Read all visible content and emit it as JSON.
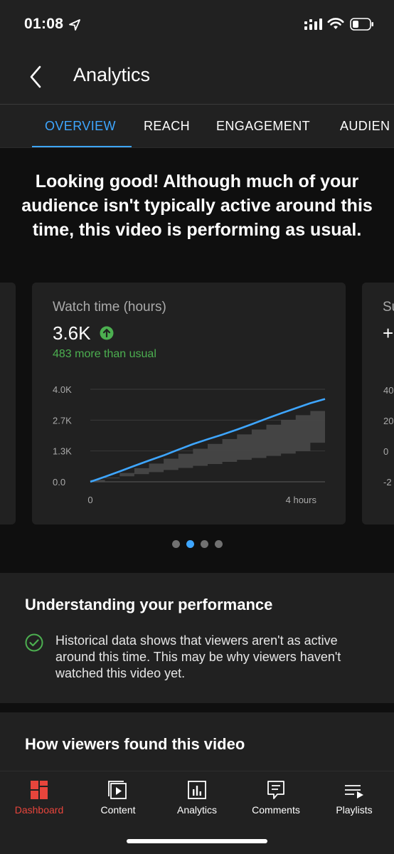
{
  "status_bar": {
    "time": "01:08"
  },
  "header": {
    "title": "Analytics"
  },
  "tabs": [
    {
      "label": "OVERVIEW",
      "active": true
    },
    {
      "label": "REACH",
      "active": false
    },
    {
      "label": "ENGAGEMENT",
      "active": false
    },
    {
      "label": "AUDIEN",
      "active": false
    }
  ],
  "headline": "Looking good! Although much of your audience isn't typically active around this time, this video is performing as usual.",
  "card": {
    "label": "Watch time (hours)",
    "value": "3.6K",
    "comparison": "483 more than usual"
  },
  "peek_card": {
    "label": "Su",
    "value": "+",
    "ticks": [
      "40",
      "20",
      "0",
      "-2"
    ]
  },
  "chart_data": {
    "type": "line",
    "title": "",
    "xlabel": "",
    "ylabel": "",
    "x_ticks": [
      "0",
      "4 hours"
    ],
    "y_ticks": [
      "4.0K",
      "2.7K",
      "1.3K",
      "0.0"
    ],
    "x_range": [
      0,
      4
    ],
    "ylim": [
      0,
      4000
    ],
    "grid": true,
    "series": [
      {
        "type": "line",
        "color": "#3ea6ff",
        "x": [
          0,
          0.25,
          0.5,
          0.75,
          1.0,
          1.25,
          1.5,
          1.75,
          2.0,
          2.25,
          2.5,
          2.75,
          3.0,
          3.25,
          3.5,
          3.75,
          4.0
        ],
        "y": [
          0,
          220,
          450,
          690,
          920,
          1140,
          1390,
          1630,
          1840,
          2040,
          2260,
          2490,
          2730,
          2960,
          3180,
          3400,
          3580
        ]
      },
      {
        "type": "band",
        "color": "#4a4a4a",
        "x": [
          0,
          0.25,
          0.5,
          0.75,
          1.0,
          1.25,
          1.5,
          1.75,
          2.0,
          2.25,
          2.5,
          2.75,
          3.0,
          3.25,
          3.5,
          3.75,
          4.0
        ],
        "low": [
          0,
          80,
          150,
          240,
          330,
          420,
          510,
          600,
          690,
          770,
          860,
          950,
          1030,
          1120,
          1220,
          1330,
          1690
        ],
        "high": [
          0,
          180,
          380,
          590,
          790,
          1000,
          1210,
          1430,
          1640,
          1850,
          2050,
          2260,
          2470,
          2680,
          2880,
          3060,
          3020
        ]
      }
    ]
  },
  "pager": {
    "count": 4,
    "active_index": 1
  },
  "understanding": {
    "title": "Understanding your performance",
    "insight": "Historical data shows that viewers aren't as active around this time. This may be why viewers haven't watched this video yet."
  },
  "how_found": {
    "title": "How viewers found this video"
  },
  "nav": [
    {
      "label": "Dashboard",
      "icon": "dashboard-icon",
      "active": true
    },
    {
      "label": "Content",
      "icon": "content-icon",
      "active": false
    },
    {
      "label": "Analytics",
      "icon": "analytics-icon",
      "active": false
    },
    {
      "label": "Comments",
      "icon": "comments-icon",
      "active": false
    },
    {
      "label": "Playlists",
      "icon": "playlists-icon",
      "active": false
    }
  ],
  "colors": {
    "accent": "#3ea6ff",
    "positive": "#4caf50",
    "active_nav": "#e8453c"
  }
}
